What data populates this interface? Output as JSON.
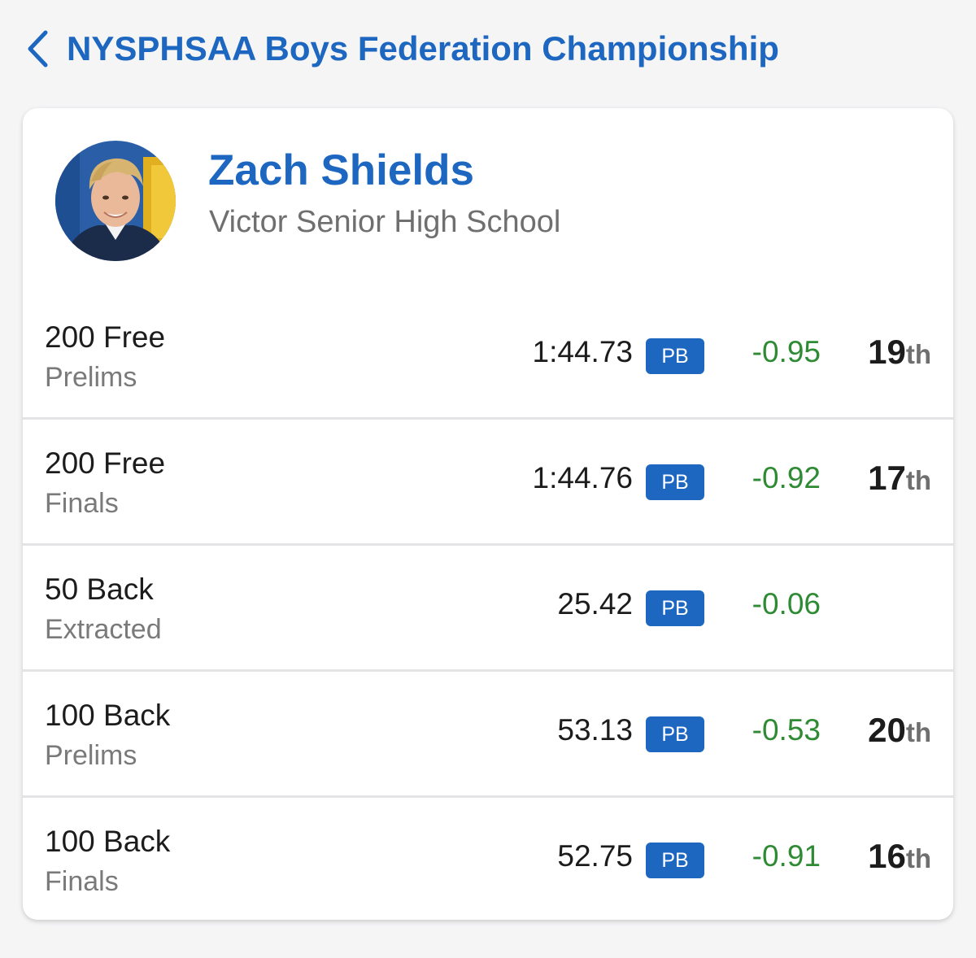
{
  "header": {
    "back_icon": "chevron-left-icon",
    "title": "NYSPHSAA Boys Federation Championship"
  },
  "colors": {
    "accent": "#1d67c1",
    "positive": "#2e8b33",
    "background": "#f5f5f6"
  },
  "swimmer": {
    "name": "Zach Shields",
    "school": "Victor Senior High School"
  },
  "results": [
    {
      "event": "200 Free",
      "round": "Prelims",
      "time": "1:44.73",
      "badge": "PB",
      "delta": "-0.95",
      "place": "19",
      "place_suffix": "th"
    },
    {
      "event": "200 Free",
      "round": "Finals",
      "time": "1:44.76",
      "badge": "PB",
      "delta": "-0.92",
      "place": "17",
      "place_suffix": "th"
    },
    {
      "event": "50 Back",
      "round": "Extracted",
      "time": "25.42",
      "badge": "PB",
      "delta": "-0.06",
      "place": "",
      "place_suffix": ""
    },
    {
      "event": "100 Back",
      "round": "Prelims",
      "time": "53.13",
      "badge": "PB",
      "delta": "-0.53",
      "place": "20",
      "place_suffix": "th"
    },
    {
      "event": "100 Back",
      "round": "Finals",
      "time": "52.75",
      "badge": "PB",
      "delta": "-0.91",
      "place": "16",
      "place_suffix": "th"
    }
  ]
}
